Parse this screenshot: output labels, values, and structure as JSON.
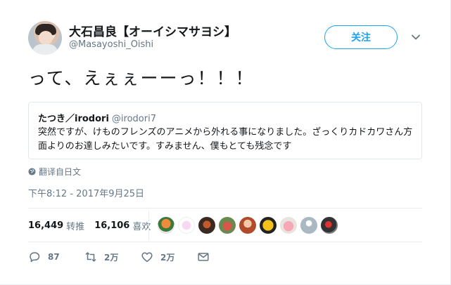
{
  "tweet": {
    "display_name": "大石昌良【オーイシマサヨシ】",
    "handle": "@Masayoshi_Oishi",
    "text": "って、えぇぇーーっ！！！",
    "timestamp": "下午8:12 - 2017年9月25日",
    "translate_label": "翻译自日文"
  },
  "follow_button": {
    "label": "关注"
  },
  "quote": {
    "name": "たつき／irodori",
    "handle": "@irodori7",
    "text": "突然ですが、けものフレンズのアニメから外れる事になりました。ざっくりカドカワさん方面よりのお達しみたいです。すみません、僕もとても残念です"
  },
  "stats": {
    "retweets": {
      "count": "16,449",
      "label": "转推"
    },
    "likes": {
      "count": "16,106",
      "label": "喜欢"
    }
  },
  "actions": {
    "reply_count": "87",
    "retweet_count": "2万",
    "like_count": "2万"
  },
  "colors": {
    "accent": "#1da1f2",
    "muted": "#657786",
    "border": "#e6ecf0"
  }
}
